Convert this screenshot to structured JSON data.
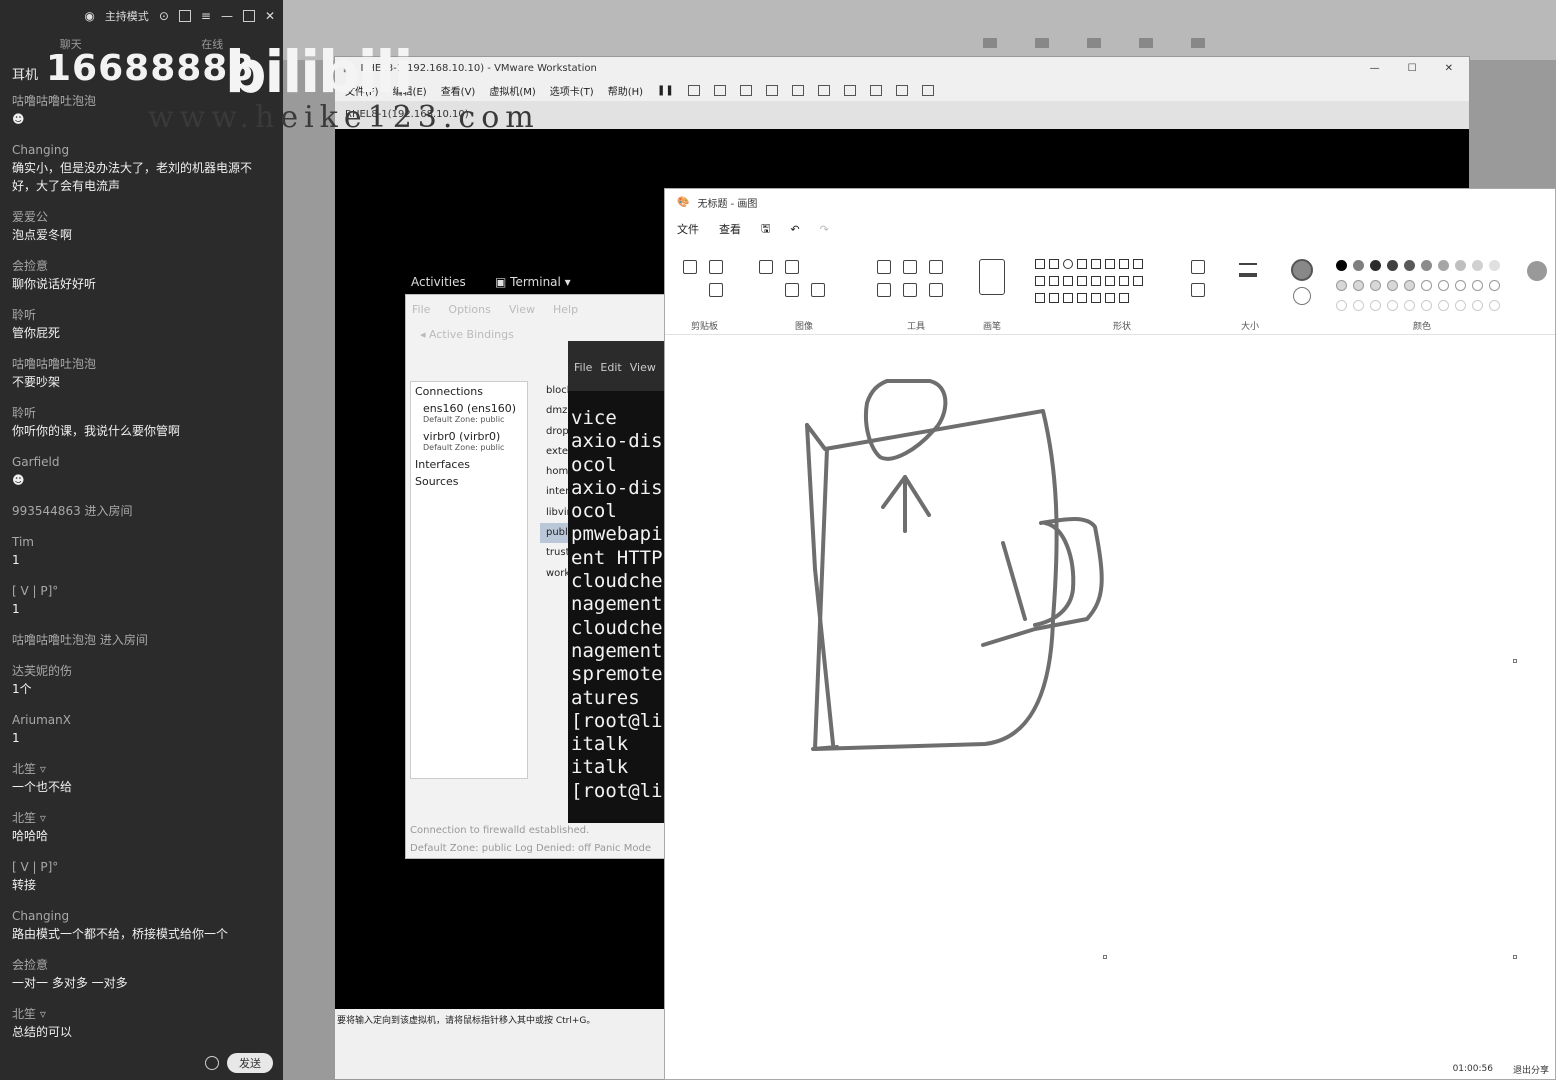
{
  "chat": {
    "mode": "主持模式",
    "tabs": [
      "聊天",
      "在线"
    ],
    "watermark_number": "16688888",
    "small_title": "耳机",
    "messages": [
      {
        "user": "咕噜咕噜吐泡泡",
        "text": "☻"
      },
      {
        "user": "Changing",
        "text": "确实小，但是没办法大了，老刘的机器电源不好，大了会有电流声"
      },
      {
        "user": "爱爱公",
        "text": "泡点爱冬啊"
      },
      {
        "user": "会捡意",
        "text": "聊你说话好好听"
      },
      {
        "user": "聆听",
        "text": "管你屁死"
      },
      {
        "user": "咕噜咕噜吐泡泡",
        "text": "不要吵架"
      },
      {
        "user": "聆听",
        "text": "你听你的课，我说什么要你管啊"
      },
      {
        "user": "Garfield",
        "text": "☻"
      },
      {
        "user": "993544863 进入房间",
        "text": ""
      },
      {
        "user": "Tim",
        "text": "1"
      },
      {
        "user": "[  V  |  P]°",
        "text": "1"
      },
      {
        "user": "咕噜咕噜吐泡泡 进入房间",
        "text": ""
      },
      {
        "user": "达芙妮的伤",
        "text": "1个"
      },
      {
        "user": "AriumanX",
        "text": "1"
      },
      {
        "user": "北笙 ▿",
        "text": "一个也不给"
      },
      {
        "user": "北笙 ▿",
        "text": "哈哈哈"
      },
      {
        "user": "[  V  |  P]°",
        "text": "转接"
      },
      {
        "user": "Changing",
        "text": "路由模式一个都不给，桥接模式给你一个"
      },
      {
        "user": "会捡意",
        "text": "一对一 多对多 一对多"
      },
      {
        "user": "北笙 ▿",
        "text": "总结的可以"
      }
    ],
    "send_label": "发送"
  },
  "watermarks": {
    "logo": "bilibili",
    "site": "www.heike123.com"
  },
  "vmware": {
    "title": "RHEL8-1(192.168.10.10) - VMware Workstation",
    "menu": [
      "文件(F)",
      "编辑(E)",
      "查看(V)",
      "虚拟机(M)",
      "选项卡(T)",
      "帮助(H)"
    ],
    "tab": "RHEL8-1(192.168.10.10)",
    "status": "要将输入定向到该虚拟机，请将鼠标指针移入其中或按 Ctrl+G。"
  },
  "gnome": {
    "activities": "Activities",
    "terminal_menu": "▣ Terminal ▾"
  },
  "firewall": {
    "menu": [
      "File",
      "Options",
      "View",
      "Help"
    ],
    "bindings": "◂ Active Bindings",
    "connections_header": "Connections",
    "connections": [
      {
        "name": "ens160 (ens160)",
        "zone": "Default Zone: public"
      },
      {
        "name": "virbr0 (virbr0)",
        "zone": "Default Zone: public"
      }
    ],
    "interfaces": "Interfaces",
    "sources": "Sources",
    "zones": [
      "block",
      "dmz",
      "drop",
      "external",
      "home",
      "internal",
      "libvirt",
      "public",
      "trusted",
      "work"
    ],
    "selected_zone": "public",
    "status1": "Connection to firewalld established.",
    "status2": "Default Zone: public   Log Denied: off   Panic Mode"
  },
  "terminal": {
    "menu": [
      "File",
      "Edit",
      "View"
    ],
    "lines": [
      "vice",
      "axio-dis",
      "ocol",
      "axio-dis",
      "ocol",
      "pmwebapi",
      "ent HTTP",
      "cloudche",
      "nagement",
      "cloudche",
      "nagement",
      "spremote",
      "atures",
      "[root@li",
      "italk",
      "italk",
      "[root@li"
    ]
  },
  "paint": {
    "title": "无标题 - 画图",
    "menu": [
      "文件",
      "查看"
    ],
    "groups": [
      "剪贴板",
      "图像",
      "工具",
      "画笔",
      "形状",
      "大小",
      "颜色"
    ],
    "status_time": "01:00:56",
    "status_exit": "退出分享",
    "colors": [
      "#000000",
      "#7f7f7f",
      "#2b2b2b",
      "#404040",
      "#595959",
      "#8c8c8c",
      "#a6a6a6",
      "#bfbfbf",
      "#d0d0d0",
      "#e0e0e0"
    ]
  }
}
